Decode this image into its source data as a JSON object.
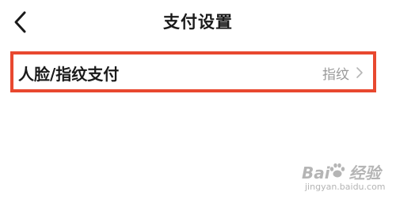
{
  "nav": {
    "title": "支付设置"
  },
  "settings": {
    "row": {
      "label": "人脸/指纹支付",
      "value": "指纹"
    }
  },
  "watermark": {
    "brand_prefix": "Bai",
    "brand_suffix": "经验",
    "url": "jingyan.baidu.com"
  },
  "colors": {
    "highlight_border": "#e8482f",
    "text_primary": "#1a1a1a",
    "text_secondary": "#9a9a9a"
  },
  "icons": {
    "back": "chevron-left-icon",
    "row_arrow": "chevron-right-icon",
    "watermark_logo": "paw-icon"
  }
}
